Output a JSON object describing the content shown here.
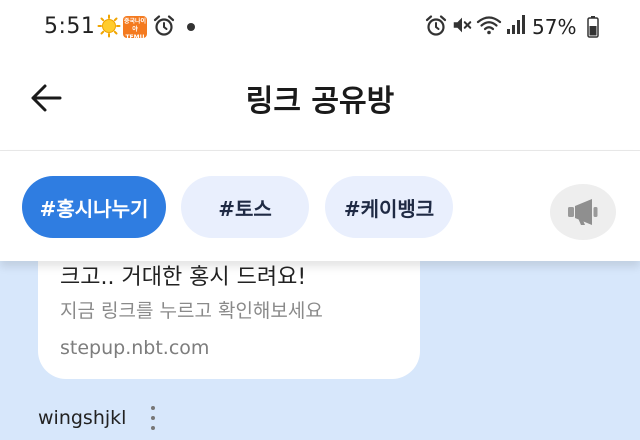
{
  "status_bar": {
    "time": "5:51",
    "temu_label_top": "중국나이야",
    "temu_label_bottom": "TEMU",
    "battery": "57%",
    "icons": [
      "sun-icon",
      "temu-app-icon",
      "alarm-icon",
      "notification-dot",
      "alarm-icon",
      "mute-icon",
      "wifi-icon",
      "signal-icon",
      "battery-icon"
    ]
  },
  "header": {
    "title": "링크 공유방",
    "back_icon": "arrow-left-icon"
  },
  "chips": [
    {
      "label": "#홍시나누기",
      "active": true
    },
    {
      "label": "#토스",
      "active": false
    },
    {
      "label": "#케이뱅크",
      "active": false
    }
  ],
  "megaphone_icon": "megaphone-icon",
  "post": {
    "title": "크고.. 거대한 홍시 드려요!",
    "subtitle": "지금 링크를 누르고 확인해보세요",
    "url": "stepup.nbt.com",
    "author": "wingshjkl"
  },
  "colors": {
    "accent": "#2f7de1",
    "chip_bg": "#e9effd",
    "content_bg": "#d7e7fb"
  }
}
